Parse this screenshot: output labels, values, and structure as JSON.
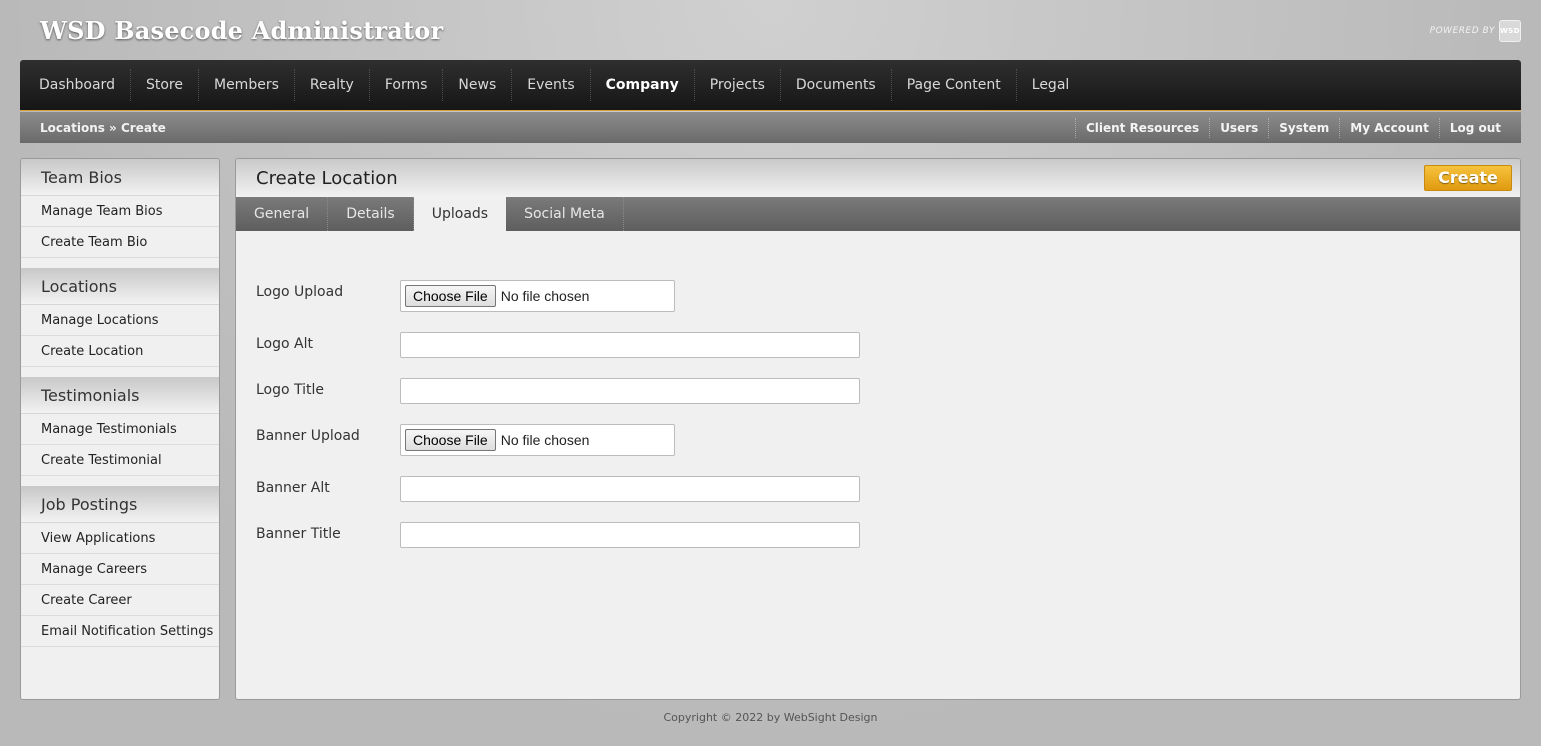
{
  "site": {
    "title": "WSD Basecode Administrator",
    "powered_by": "POWERED BY",
    "logo_text": "WSD"
  },
  "main_nav": [
    {
      "label": "Dashboard",
      "active": false
    },
    {
      "label": "Store",
      "active": false
    },
    {
      "label": "Members",
      "active": false
    },
    {
      "label": "Realty",
      "active": false
    },
    {
      "label": "Forms",
      "active": false
    },
    {
      "label": "News",
      "active": false
    },
    {
      "label": "Events",
      "active": false
    },
    {
      "label": "Company",
      "active": true
    },
    {
      "label": "Projects",
      "active": false
    },
    {
      "label": "Documents",
      "active": false
    },
    {
      "label": "Page Content",
      "active": false
    },
    {
      "label": "Legal",
      "active": false
    }
  ],
  "breadcrumb": "Locations » Create",
  "util_nav": [
    "Client Resources",
    "Users",
    "System",
    "My Account",
    "Log out"
  ],
  "sidebar": [
    {
      "heading": "Team Bios",
      "links": [
        "Manage Team Bios",
        "Create Team Bio"
      ]
    },
    {
      "heading": "Locations",
      "links": [
        "Manage Locations",
        "Create Location"
      ]
    },
    {
      "heading": "Testimonials",
      "links": [
        "Manage Testimonials",
        "Create Testimonial"
      ]
    },
    {
      "heading": "Job Postings",
      "links": [
        "View Applications",
        "Manage Careers",
        "Create Career",
        "Email Notification Settings"
      ]
    }
  ],
  "panel": {
    "title": "Create Location",
    "create_label": "Create",
    "tabs": [
      {
        "label": "General",
        "active": false
      },
      {
        "label": "Details",
        "active": false
      },
      {
        "label": "Uploads",
        "active": true
      },
      {
        "label": "Social Meta",
        "active": false
      }
    ]
  },
  "form": {
    "logo_upload_label": "Logo Upload",
    "logo_alt_label": "Logo Alt",
    "logo_title_label": "Logo Title",
    "banner_upload_label": "Banner Upload",
    "banner_alt_label": "Banner Alt",
    "banner_title_label": "Banner Title",
    "choose_file": "Choose File",
    "no_file": "No file chosen",
    "logo_alt_value": "",
    "logo_title_value": "",
    "banner_alt_value": "",
    "banner_title_value": ""
  },
  "footer": "Copyright © 2022 by WebSight Design",
  "colors": {
    "accent": "#e6a81c",
    "nav_bg": "#1f1f1f",
    "subnav_bg": "#7a7a7a"
  }
}
